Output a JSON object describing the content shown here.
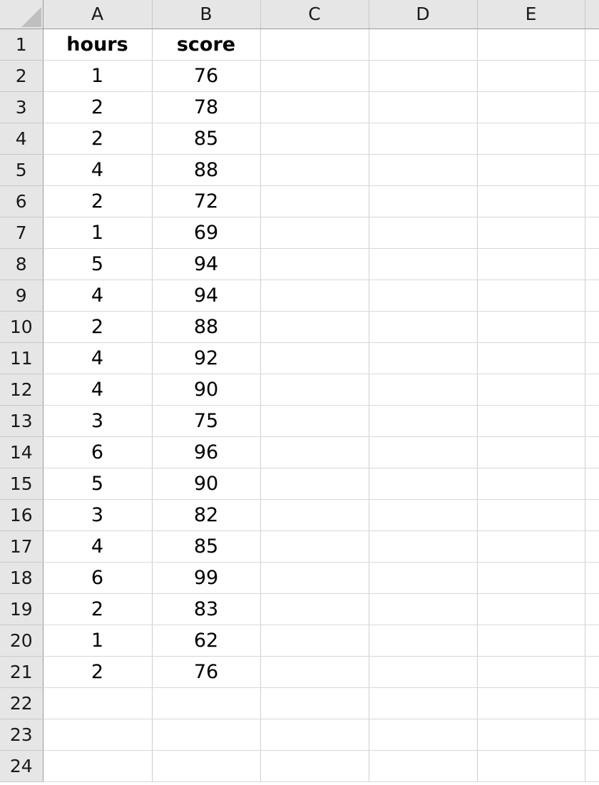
{
  "spreadsheet": {
    "corner_icon": "select-all-triangle-icon",
    "column_headers": [
      "A",
      "B",
      "C",
      "D",
      "E",
      ""
    ],
    "row_numbers": [
      "1",
      "2",
      "3",
      "4",
      "5",
      "6",
      "7",
      "8",
      "9",
      "10",
      "11",
      "12",
      "13",
      "14",
      "15",
      "16",
      "17",
      "18",
      "19",
      "20",
      "21",
      "22",
      "23",
      "24"
    ],
    "colors": {
      "header_background": "#e6e6e6",
      "header_text": "#1a1a1a",
      "cell_background": "#ffffff",
      "cell_text": "#000000",
      "gridline": "#d0d0d0",
      "header_divider": "#9a9a9a",
      "corner_triangle": "#bfbfbf"
    },
    "rows": [
      {
        "number": "1",
        "cells": [
          "hours",
          "score",
          "",
          "",
          "",
          ""
        ],
        "bold": true
      },
      {
        "number": "2",
        "cells": [
          "1",
          "76",
          "",
          "",
          "",
          ""
        ],
        "bold": false
      },
      {
        "number": "3",
        "cells": [
          "2",
          "78",
          "",
          "",
          "",
          ""
        ],
        "bold": false
      },
      {
        "number": "4",
        "cells": [
          "2",
          "85",
          "",
          "",
          "",
          ""
        ],
        "bold": false
      },
      {
        "number": "5",
        "cells": [
          "4",
          "88",
          "",
          "",
          "",
          ""
        ],
        "bold": false
      },
      {
        "number": "6",
        "cells": [
          "2",
          "72",
          "",
          "",
          "",
          ""
        ],
        "bold": false
      },
      {
        "number": "7",
        "cells": [
          "1",
          "69",
          "",
          "",
          "",
          ""
        ],
        "bold": false
      },
      {
        "number": "8",
        "cells": [
          "5",
          "94",
          "",
          "",
          "",
          ""
        ],
        "bold": false
      },
      {
        "number": "9",
        "cells": [
          "4",
          "94",
          "",
          "",
          "",
          ""
        ],
        "bold": false
      },
      {
        "number": "10",
        "cells": [
          "2",
          "88",
          "",
          "",
          "",
          ""
        ],
        "bold": false
      },
      {
        "number": "11",
        "cells": [
          "4",
          "92",
          "",
          "",
          "",
          ""
        ],
        "bold": false
      },
      {
        "number": "12",
        "cells": [
          "4",
          "90",
          "",
          "",
          "",
          ""
        ],
        "bold": false
      },
      {
        "number": "13",
        "cells": [
          "3",
          "75",
          "",
          "",
          "",
          ""
        ],
        "bold": false
      },
      {
        "number": "14",
        "cells": [
          "6",
          "96",
          "",
          "",
          "",
          ""
        ],
        "bold": false
      },
      {
        "number": "15",
        "cells": [
          "5",
          "90",
          "",
          "",
          "",
          ""
        ],
        "bold": false
      },
      {
        "number": "16",
        "cells": [
          "3",
          "82",
          "",
          "",
          "",
          ""
        ],
        "bold": false
      },
      {
        "number": "17",
        "cells": [
          "4",
          "85",
          "",
          "",
          "",
          ""
        ],
        "bold": false
      },
      {
        "number": "18",
        "cells": [
          "6",
          "99",
          "",
          "",
          "",
          ""
        ],
        "bold": false
      },
      {
        "number": "19",
        "cells": [
          "2",
          "83",
          "",
          "",
          "",
          ""
        ],
        "bold": false
      },
      {
        "number": "20",
        "cells": [
          "1",
          "62",
          "",
          "",
          "",
          ""
        ],
        "bold": false
      },
      {
        "number": "21",
        "cells": [
          "2",
          "76",
          "",
          "",
          "",
          ""
        ],
        "bold": false
      },
      {
        "number": "22",
        "cells": [
          "",
          "",
          "",
          "",
          "",
          ""
        ],
        "bold": false
      },
      {
        "number": "23",
        "cells": [
          "",
          "",
          "",
          "",
          "",
          ""
        ],
        "bold": false
      },
      {
        "number": "24",
        "cells": [
          "",
          "",
          "",
          "",
          "",
          ""
        ],
        "bold": false
      }
    ],
    "table_data": {
      "headers": [
        "hours",
        "score"
      ],
      "hours": [
        1,
        2,
        2,
        4,
        2,
        1,
        5,
        4,
        2,
        4,
        4,
        3,
        6,
        5,
        3,
        4,
        6,
        2,
        1,
        2
      ],
      "score": [
        76,
        78,
        85,
        88,
        72,
        69,
        94,
        94,
        88,
        92,
        90,
        75,
        96,
        90,
        82,
        85,
        99,
        83,
        62,
        76
      ]
    }
  }
}
